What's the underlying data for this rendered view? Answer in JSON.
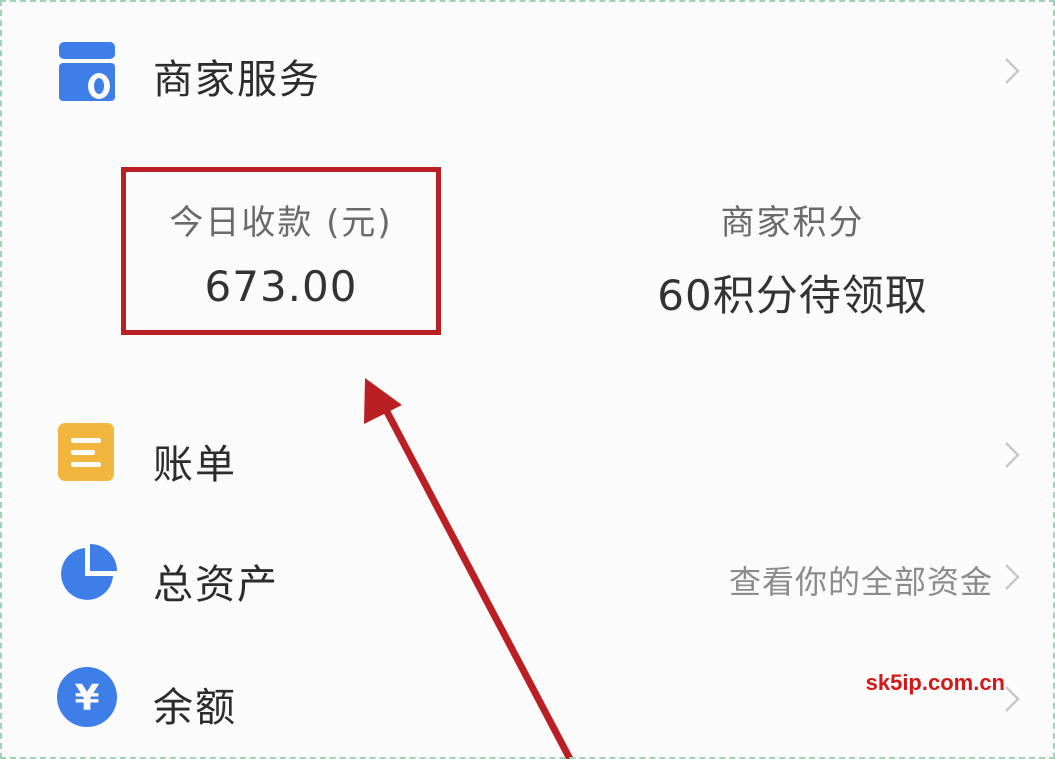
{
  "merchant_services": {
    "label": "商家服务",
    "icon": "store-icon"
  },
  "today_receipts": {
    "label": "今日收款 (元)",
    "value": "673.00"
  },
  "merchant_points": {
    "label": "商家积分",
    "value": "60积分待领取"
  },
  "menu": {
    "bill": {
      "label": "账单",
      "icon": "bill-icon"
    },
    "total_assets": {
      "label": "总资产",
      "hint": "查看你的全部资金",
      "icon": "pie-chart-icon"
    },
    "balance": {
      "label": "余额",
      "icon": "yuan-coin-icon"
    }
  },
  "watermark": "sk5ip.com.cn",
  "colors": {
    "accent_blue": "#3d7ee8",
    "bill_orange": "#f0b63d",
    "highlight_red": "#b91f23",
    "watermark_red": "#d41818"
  }
}
